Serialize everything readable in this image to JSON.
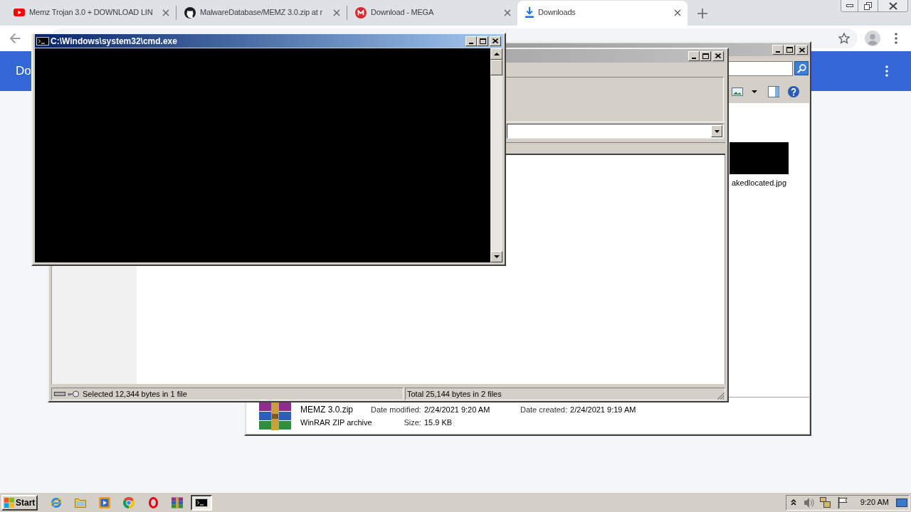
{
  "browser": {
    "tabs": [
      {
        "title": "Memz Trojan 3.0 + DOWNLOAD LIN",
        "kind": "play",
        "selected": false
      },
      {
        "title": "MalwareDatabase/MEMZ 3.0.zip at r",
        "kind": "cat",
        "selected": false
      },
      {
        "title": "Download - MEGA",
        "kind": "m-logo",
        "selected": false
      },
      {
        "title": "Downloads",
        "kind": "download",
        "selected": true
      }
    ],
    "page_title": "Do"
  },
  "windows": [
    {
      "kind": "explorer",
      "active": false,
      "files": [
        {
          "name": "akedlocated.jpg"
        }
      ],
      "details": {
        "name": "MEMZ 3.0.zip",
        "type": "WinRAR ZIP archive",
        "properties": [
          {
            "label": "Date modified:",
            "value": "2/24/2021 9:20 AM"
          },
          {
            "label": "Size:",
            "value": "15.9 KB"
          },
          {
            "label": "Date created:",
            "value": "2/24/2021 9:19 AM"
          }
        ]
      }
    },
    {
      "kind": "dialog",
      "active": false,
      "status": [
        "Selected 12,344 bytes in 1 file",
        "Total 25,144 bytes in 2 files"
      ]
    },
    {
      "kind": "console",
      "active": true,
      "title": "C:\\Windows\\system32\\cmd.exe"
    }
  ],
  "taskbar": {
    "start": "Start",
    "items": [
      {
        "kind": "globe",
        "selected": false
      },
      {
        "kind": "folder",
        "selected": false
      },
      {
        "kind": "player",
        "selected": false
      },
      {
        "kind": "tricolor",
        "selected": false
      },
      {
        "kind": "ring",
        "selected": false
      },
      {
        "kind": "books",
        "selected": false
      },
      {
        "kind": "console",
        "selected": true
      }
    ],
    "clock": "9:20 AM"
  }
}
